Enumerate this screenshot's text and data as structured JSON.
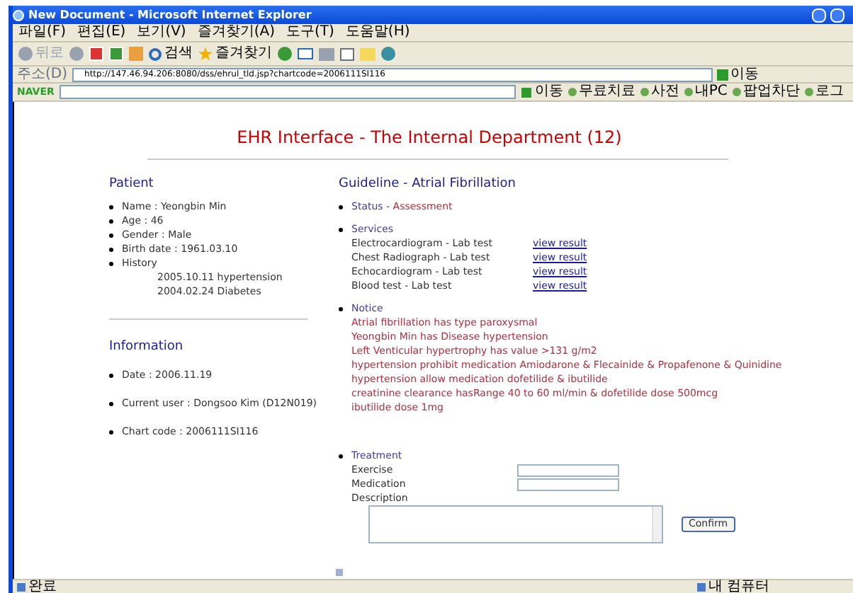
{
  "window": {
    "title": "New Document - Microsoft Internet Explorer"
  },
  "menu": [
    "파일(F)",
    "편집(E)",
    "보기(V)",
    "즐겨찾기(A)",
    "도구(T)",
    "도움말(H)"
  ],
  "toolbar": {
    "back": "뒤로",
    "search": "검색",
    "favorites": "즐겨찾기"
  },
  "address": {
    "label": "주소(D)",
    "url": "http://147.46.94.206:8080/dss/ehrul_tld.jsp?chartcode=2006111SI116",
    "go": "이동"
  },
  "naver_bar": {
    "brand": "NAVER",
    "go": "이동",
    "links": [
      "무료치료",
      "사전",
      "내PC",
      "팝업차단",
      "로그"
    ]
  },
  "page": {
    "title": "EHR Interface - The Internal Department (12)",
    "patient": {
      "heading": "Patient",
      "items": [
        "Name : Yeongbin Min",
        "Age : 46",
        "Gender : Male",
        "Birth date : 1961.03.10",
        "History"
      ],
      "history": [
        "2005.10.11 hypertension",
        "2004.02.24 Diabetes"
      ]
    },
    "information": {
      "heading": "Information",
      "items": [
        "Date : 2006.11.19",
        "Current user : Dongsoo Kim (D12N019)",
        "Chart code : 2006111SI116"
      ]
    },
    "guideline": {
      "heading": "Guideline - Atrial Fibrillation",
      "status": {
        "label": "Status - ",
        "value": "Assessment"
      },
      "services": {
        "label": "Services",
        "rows": [
          {
            "name": "Electrocardiogram - Lab test",
            "link": "view result"
          },
          {
            "name": "Chest Radiograph - Lab test",
            "link": "view result"
          },
          {
            "name": "Echocardiogram - Lab test",
            "link": "view result"
          },
          {
            "name": "Blood test - Lab test",
            "link": "view result"
          }
        ]
      },
      "notice": {
        "label": "Notice",
        "lines": [
          "Atrial fibrillation has type paroxysmal",
          "Yeongbin Min has Disease hypertension",
          "Left Venticular hypertrophy has value >131 g/m2",
          "hypertension prohibit medication Amiodarone & Flecainide & Propafenone & Quinidine",
          "hypertension allow medication dofetilide & ibutilide",
          "creatinine clearance hasRange 40 to 60 ml/min & dofetilide dose 500mcg",
          "ibutilide dose 1mg"
        ]
      },
      "treatment": {
        "label": "Treatment",
        "fields": [
          {
            "label": "Exercise",
            "kind": "input"
          },
          {
            "label": "Medication",
            "kind": "input"
          },
          {
            "label": "Description",
            "kind": "textarea"
          }
        ],
        "button": "Confirm"
      }
    }
  },
  "status_bar": {
    "text": "완료",
    "zone": "내 컴퓨터"
  }
}
